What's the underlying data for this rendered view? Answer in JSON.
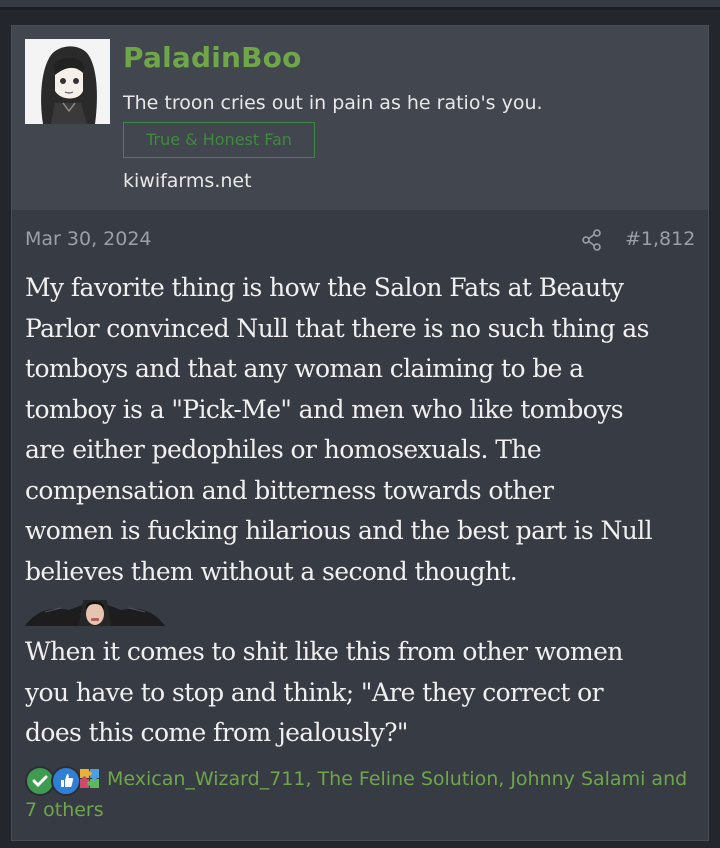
{
  "post": {
    "username": "PaladinBoo",
    "user_title": "The troon cries out in pain as he ratio's you.",
    "banner": "True & Honest Fan",
    "website": "kiwifarms.net",
    "date": "Mar 30, 2024",
    "post_number": "#1,812",
    "message_lines": [
      "My favorite thing is how the Salon Fats at Beauty",
      "Parlor convinced Null that there is no such thing as",
      "tomboys and that any woman claiming to be a",
      "tomboy is a \"Pick-Me\" and men who like tomboys",
      "are either pedophiles or homosexuals. The",
      "compensation and bitterness towards other",
      "women is fucking hilarious and the best part is Null",
      "believes them without a second thought."
    ],
    "message2_lines": [
      "When it comes to shit like this from other women",
      "you have to stop and think; \"Are they correct or",
      "does this come from jealously?\""
    ],
    "reactions": {
      "icons": [
        "check-reaction-icon",
        "thumbs-up-reaction-icon",
        "puzzle-reaction-icon"
      ],
      "users": "Mexican_Wizard_711, The Feline Solution, Johnny Salami",
      "others": "and 7 others"
    }
  },
  "colors": {
    "username": "#6fa64a",
    "banner": "#3e8a3e",
    "background": "#373b43"
  }
}
